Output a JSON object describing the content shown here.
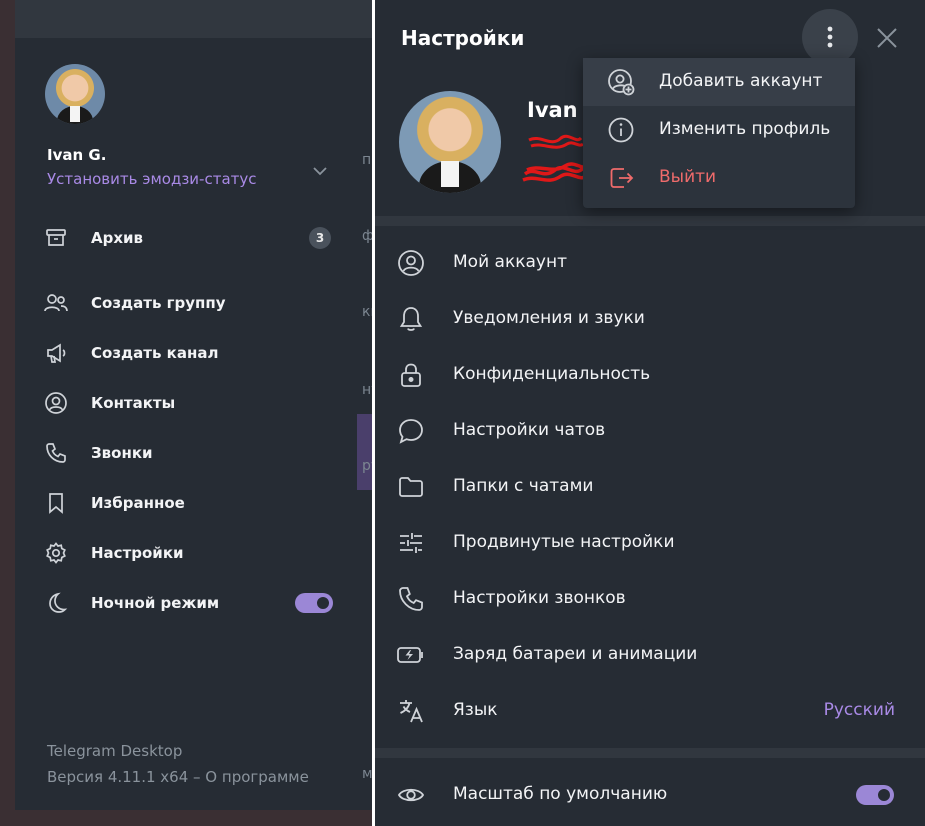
{
  "colors": {
    "panel_bg": "#262c34",
    "accent": "#a98ae6",
    "toggle": "#9b87d6",
    "danger": "#ef6b6b",
    "muted_text": "#8a939c",
    "separator": "#31373f"
  },
  "left_menu": {
    "user_name": "Ivan G.",
    "emoji_status_link": "Установить эмодзи-статус",
    "items": [
      {
        "icon": "archive-icon",
        "label": "Архив",
        "badge": "3"
      },
      {
        "icon": "group-icon",
        "label": "Создать группу"
      },
      {
        "icon": "megaphone-icon",
        "label": "Создать канал"
      },
      {
        "icon": "contact-icon",
        "label": "Контакты"
      },
      {
        "icon": "phone-icon",
        "label": "Звонки"
      },
      {
        "icon": "bookmark-icon",
        "label": "Избранное"
      },
      {
        "icon": "gear-icon",
        "label": "Настройки"
      },
      {
        "icon": "moon-icon",
        "label": "Ночной режим",
        "toggle_on": true
      }
    ],
    "footer": {
      "app_name": "Telegram Desktop",
      "version": "Версия 4.11.1 x64 – О программе"
    },
    "background_chat_fragments": [
      "п",
      "ф",
      "ки",
      "ну",
      "ру",
      "ма"
    ]
  },
  "settings": {
    "title": "Настройки",
    "profile_name": "Ivan",
    "dropdown": [
      {
        "icon": "add-account-icon",
        "label": "Добавить аккаунт"
      },
      {
        "icon": "info-icon",
        "label": "Изменить профиль"
      },
      {
        "icon": "logout-icon",
        "label": "Выйти"
      }
    ],
    "items": [
      {
        "icon": "account-icon",
        "label": "Мой аккаунт"
      },
      {
        "icon": "bell-icon",
        "label": "Уведомления и звуки"
      },
      {
        "icon": "lock-icon",
        "label": "Конфиденциальность"
      },
      {
        "icon": "chat-bubble-icon",
        "label": "Настройки чатов"
      },
      {
        "icon": "folder-icon",
        "label": "Папки с чатами"
      },
      {
        "icon": "sliders-icon",
        "label": "Продвинутые настройки"
      },
      {
        "icon": "phone-icon",
        "label": "Настройки звонков"
      },
      {
        "icon": "battery-icon",
        "label": "Заряд батареи и анимации"
      },
      {
        "icon": "translate-icon",
        "label": "Язык",
        "value": "Русский"
      }
    ],
    "scale_item": {
      "icon": "eye-icon",
      "label": "Масштаб по умолчанию",
      "toggle_on": true
    }
  }
}
